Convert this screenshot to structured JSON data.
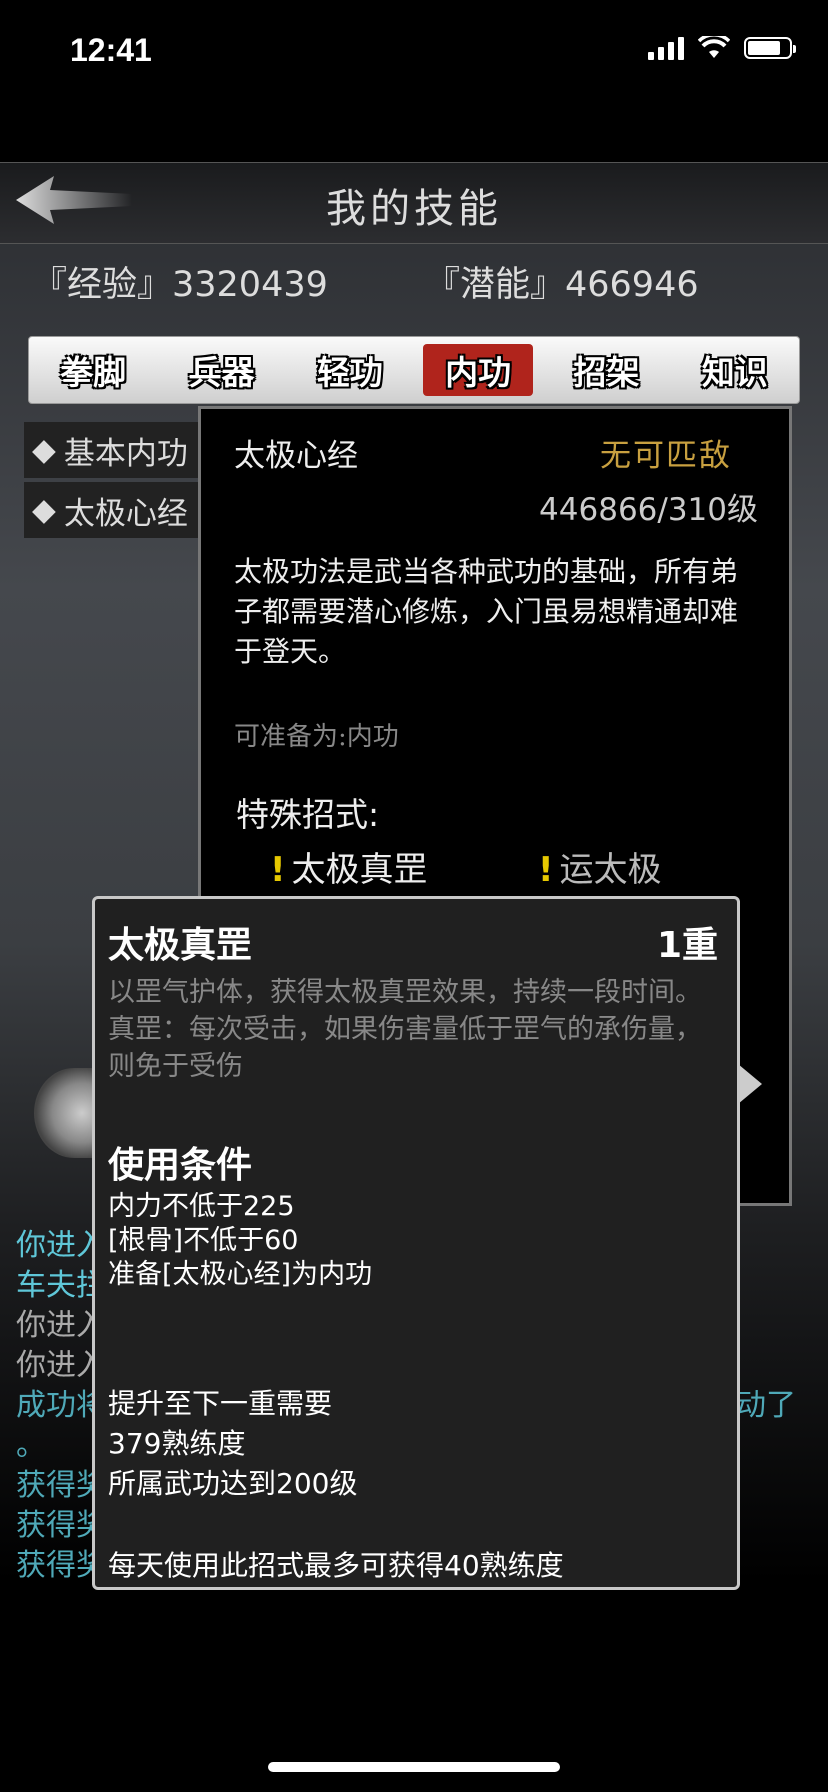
{
  "status_bar": {
    "time": "12:41"
  },
  "header": {
    "title": "我的技能"
  },
  "stats": {
    "experience": "『经验』3320439",
    "potential": "『潜能』466946"
  },
  "tabs": [
    {
      "label": "拳脚",
      "active": false
    },
    {
      "label": "兵器",
      "active": false
    },
    {
      "label": "轻功",
      "active": false
    },
    {
      "label": "内功",
      "active": true
    },
    {
      "label": "招架",
      "active": false
    },
    {
      "label": "知识",
      "active": false
    }
  ],
  "skill_list": [
    {
      "label": "基本内功"
    },
    {
      "label": "太极心经"
    }
  ],
  "detail": {
    "name": "太极心经",
    "rank": "无可匹敌",
    "level": "446866/310级",
    "description": "太极功法是武当各种武功的基础，所有弟子都需要潜心修炼，入门虽易想精通却难于登天。",
    "prepare_as": "可准备为:内功",
    "special_title": "特殊招式:",
    "specials": [
      "太极真罡",
      "运太极"
    ]
  },
  "log": {
    "line1": "你进入",
    "line2": "车夫拦",
    "line3": "你进入",
    "line4": "你进入",
    "line5": "成功将",
    "line5_end": "动了",
    "line6": "。",
    "line7": "获得奖",
    "line8": "获得奖",
    "line9": "获得奖"
  },
  "popup": {
    "name": "太极真罡",
    "tier": "1重",
    "description": "以罡气护体，获得太极真罡效果，持续一段时间。真罡：每次受击，如果伤害量低于罡气的承伤量，则免于受伤",
    "conditions_title": "使用条件",
    "conditions": [
      "内力不低于225",
      "[根骨]不低于60",
      "准备[太极心经]为内功"
    ],
    "upgrade_title": "提升至下一重需要",
    "upgrade": [
      "379熟练度",
      "所属武功达到200级"
    ],
    "daily_note": "每天使用此招式最多可获得40熟练度"
  }
}
